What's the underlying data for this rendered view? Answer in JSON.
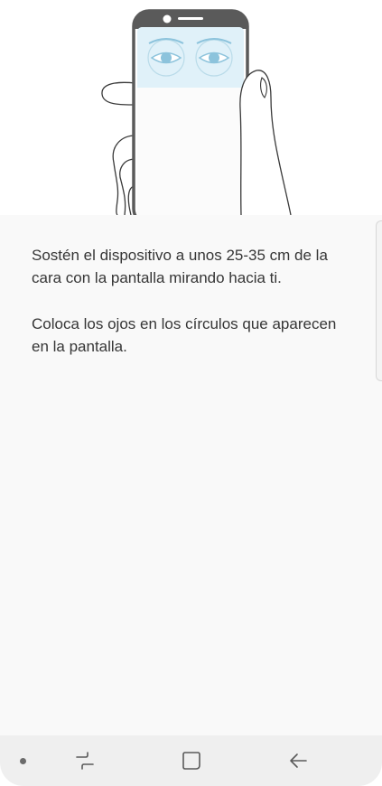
{
  "instructions": {
    "line1": "Sostén el dispositivo a unos 25-35 cm de la cara con la pantalla mirando hacia ti.",
    "line2": "Coloca los ojos en los círculos que aparecen en la pantalla."
  },
  "illustration": {
    "name": "iris-scan-guide-illustration",
    "accent_color": "#8cc3dc",
    "screen_tint": "#e0f1f9"
  },
  "navigation_bar": {
    "items": [
      "dot-indicator",
      "recent-apps-icon",
      "home-icon",
      "back-icon"
    ]
  }
}
